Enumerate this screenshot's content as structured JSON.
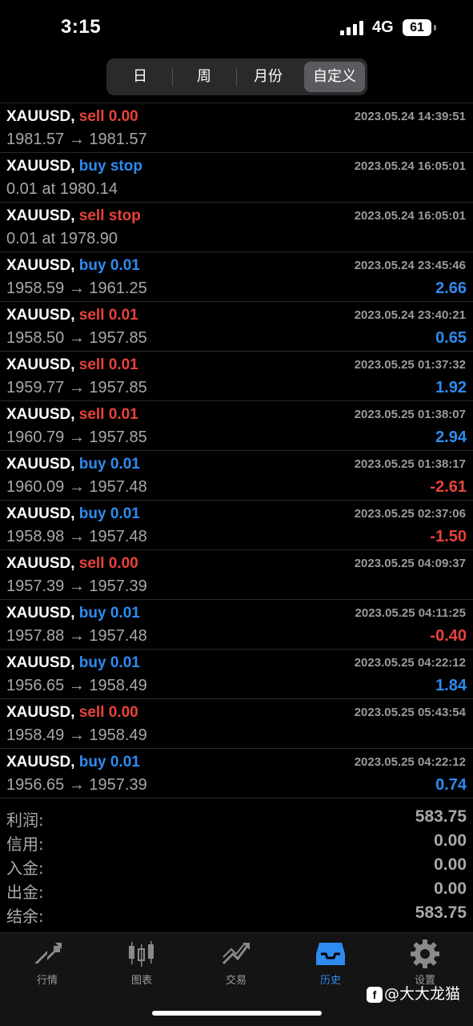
{
  "status_bar": {
    "time": "3:15",
    "network": "4G",
    "battery": "61"
  },
  "period_tabs": [
    {
      "label": "日",
      "active": false
    },
    {
      "label": "周",
      "active": false
    },
    {
      "label": "月份",
      "active": false
    },
    {
      "label": "自定义",
      "active": true
    }
  ],
  "deals": [
    {
      "symbol": "XAUUSD,",
      "side": "sell",
      "action": "sell 0.00",
      "datetime": "2023.05.24 14:39:51",
      "prices": "1981.57 → 1981.57",
      "profit": ""
    },
    {
      "symbol": "XAUUSD,",
      "side": "buy",
      "action": "buy stop",
      "datetime": "2023.05.24 16:05:01",
      "prices": "0.01 at 1980.14",
      "profit": ""
    },
    {
      "symbol": "XAUUSD,",
      "side": "sell",
      "action": "sell stop",
      "datetime": "2023.05.24 16:05:01",
      "prices": "0.01 at 1978.90",
      "profit": ""
    },
    {
      "symbol": "XAUUSD,",
      "side": "buy",
      "action": "buy 0.01",
      "datetime": "2023.05.24 23:45:46",
      "prices": "1958.59 → 1961.25",
      "profit": "2.66"
    },
    {
      "symbol": "XAUUSD,",
      "side": "sell",
      "action": "sell 0.01",
      "datetime": "2023.05.24 23:40:21",
      "prices": "1958.50 → 1957.85",
      "profit": "0.65"
    },
    {
      "symbol": "XAUUSD,",
      "side": "sell",
      "action": "sell 0.01",
      "datetime": "2023.05.25 01:37:32",
      "prices": "1959.77 → 1957.85",
      "profit": "1.92"
    },
    {
      "symbol": "XAUUSD,",
      "side": "sell",
      "action": "sell 0.01",
      "datetime": "2023.05.25 01:38:07",
      "prices": "1960.79 → 1957.85",
      "profit": "2.94"
    },
    {
      "symbol": "XAUUSD,",
      "side": "buy",
      "action": "buy 0.01",
      "datetime": "2023.05.25 01:38:17",
      "prices": "1960.09 → 1957.48",
      "profit": "-2.61"
    },
    {
      "symbol": "XAUUSD,",
      "side": "buy",
      "action": "buy 0.01",
      "datetime": "2023.05.25 02:37:06",
      "prices": "1958.98 → 1957.48",
      "profit": "-1.50"
    },
    {
      "symbol": "XAUUSD,",
      "side": "sell",
      "action": "sell 0.00",
      "datetime": "2023.05.25 04:09:37",
      "prices": "1957.39 → 1957.39",
      "profit": ""
    },
    {
      "symbol": "XAUUSD,",
      "side": "buy",
      "action": "buy 0.01",
      "datetime": "2023.05.25 04:11:25",
      "prices": "1957.88 → 1957.48",
      "profit": "-0.40"
    },
    {
      "symbol": "XAUUSD,",
      "side": "buy",
      "action": "buy 0.01",
      "datetime": "2023.05.25 04:22:12",
      "prices": "1956.65 → 1958.49",
      "profit": "1.84"
    },
    {
      "symbol": "XAUUSD,",
      "side": "sell",
      "action": "sell 0.00",
      "datetime": "2023.05.25 05:43:54",
      "prices": "1958.49 → 1958.49",
      "profit": ""
    },
    {
      "symbol": "XAUUSD,",
      "side": "buy",
      "action": "buy 0.01",
      "datetime": "2023.05.25 04:22:12",
      "prices": "1956.65 → 1957.39",
      "profit": "0.74"
    }
  ],
  "summary": [
    {
      "label": "利润:",
      "value": "583.75"
    },
    {
      "label": "信用:",
      "value": "0.00"
    },
    {
      "label": "入金:",
      "value": "0.00"
    },
    {
      "label": "出金:",
      "value": "0.00"
    },
    {
      "label": "结余:",
      "value": "583.75"
    }
  ],
  "tab_bar": [
    {
      "label": "行情",
      "icon": "quotes-icon",
      "active": false
    },
    {
      "label": "图表",
      "icon": "chart-icon",
      "active": false
    },
    {
      "label": "交易",
      "icon": "trade-icon",
      "active": false
    },
    {
      "label": "历史",
      "icon": "history-icon",
      "active": true
    },
    {
      "label": "设置",
      "icon": "settings-icon",
      "active": false
    }
  ],
  "watermark": {
    "text": "@大大龙猫"
  },
  "colors": {
    "buy": "#2e8bf0",
    "sell": "#e8433a",
    "active_tab": "#2e8bf0",
    "muted": "#a8a8a8"
  }
}
